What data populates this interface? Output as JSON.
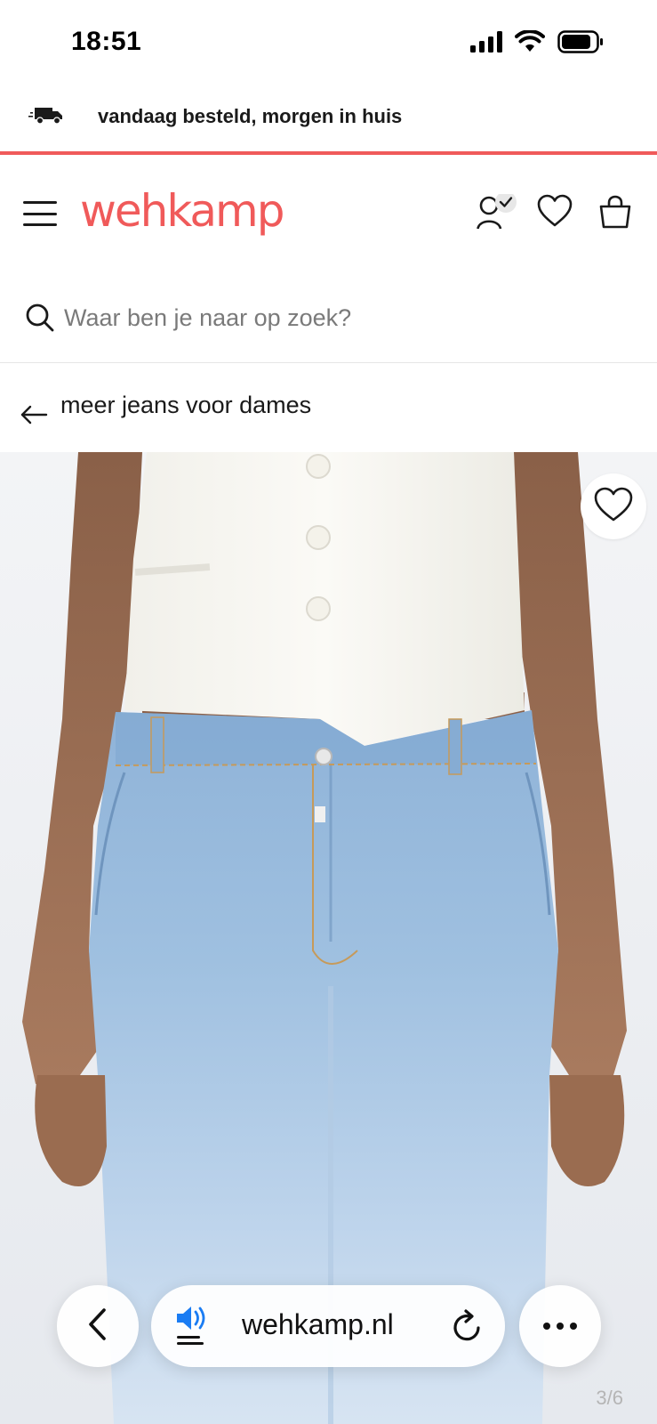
{
  "status_bar": {
    "time": "18:51"
  },
  "promo": {
    "text": "vandaag besteld, morgen in huis",
    "icon": "truck-icon"
  },
  "header": {
    "logo": "wehkamp",
    "brand_color": "#f05a5a",
    "icons": [
      "menu-icon",
      "account-icon",
      "heart-icon",
      "bag-icon"
    ]
  },
  "search": {
    "placeholder": "Waar ben je naar op zoek?",
    "value": ""
  },
  "back_link": {
    "label": "meer jeans voor dames"
  },
  "product_gallery": {
    "counter": "3/6",
    "favorite_icon": "heart-icon"
  },
  "safari": {
    "url": "wehkamp.nl",
    "icons": [
      "back-icon",
      "speaker-icon",
      "reload-icon",
      "more-icon"
    ]
  }
}
